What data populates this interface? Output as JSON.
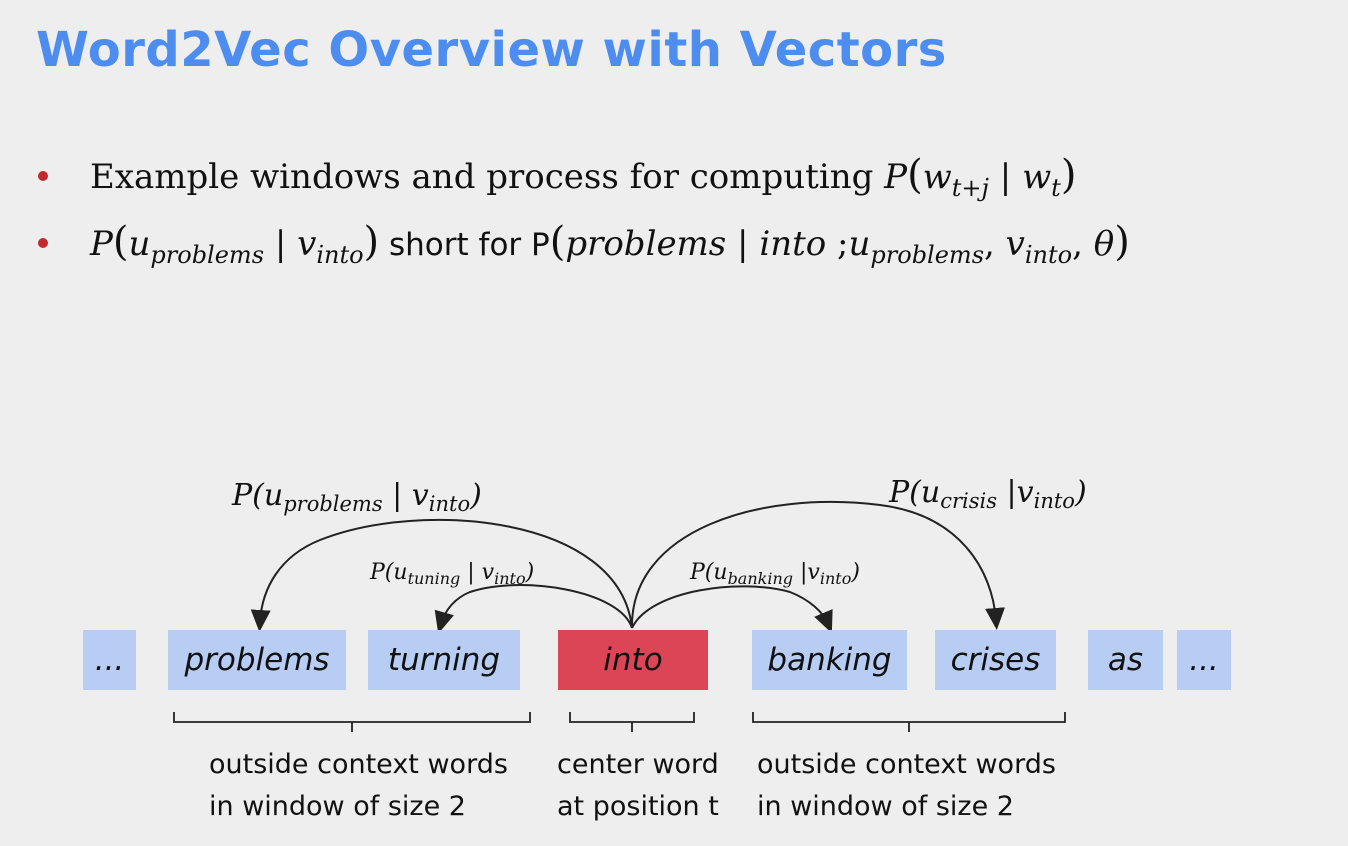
{
  "title": "Word2Vec Overview with Vectors",
  "bullets": {
    "b1_text": "Example windows and process for computing ",
    "b1_P": "P",
    "b1_w1": "w",
    "b1_w1_sub": "t+j",
    "b1_bar": " | ",
    "b1_w2": "w",
    "b1_w2_sub": "t",
    "b2_P": "P",
    "b2_u": "u",
    "b2_u_sub": "problems",
    "b2_bar": " | ",
    "b2_v": "v",
    "b2_v_sub": "into",
    "b2_short": " short for P",
    "b2_prob": "problems",
    "b2_into": "into",
    "b2_semi": " ;",
    "b2_u2": "u",
    "b2_u2_sub": "problems",
    "b2_v2": "v",
    "b2_v2_sub": "into",
    "b2_theta": "θ"
  },
  "words": [
    "...",
    "problems",
    "turning",
    "into",
    "banking",
    "crises",
    "as",
    "..."
  ],
  "arcs": {
    "problems": {
      "pre": "P(u",
      "sub": "problems",
      "mid": " | v",
      "sub2": "into",
      "post": ")"
    },
    "tuning": {
      "pre": "P(u",
      "sub": "tuning",
      "mid": " | v",
      "sub2": "into",
      "post": ")"
    },
    "banking": {
      "pre": "P(u",
      "sub": "banking",
      "mid": " |v",
      "sub2": "into",
      "post": ")"
    },
    "crisis": {
      "pre": "P(u",
      "sub": "crisis",
      "mid": " |v",
      "sub2": "into",
      "post": ")"
    }
  },
  "labels": {
    "left_1": "outside context words",
    "left_2": "in window of size 2",
    "center_1": "center word",
    "center_2": "at position t",
    "right_1": "outside context words",
    "right_2": "in window of size 2"
  },
  "colors": {
    "title": "#4d8df0",
    "bullet_dot": "#c0292e",
    "word_box": "#b8cdf4",
    "center_box": "#dc4556"
  }
}
